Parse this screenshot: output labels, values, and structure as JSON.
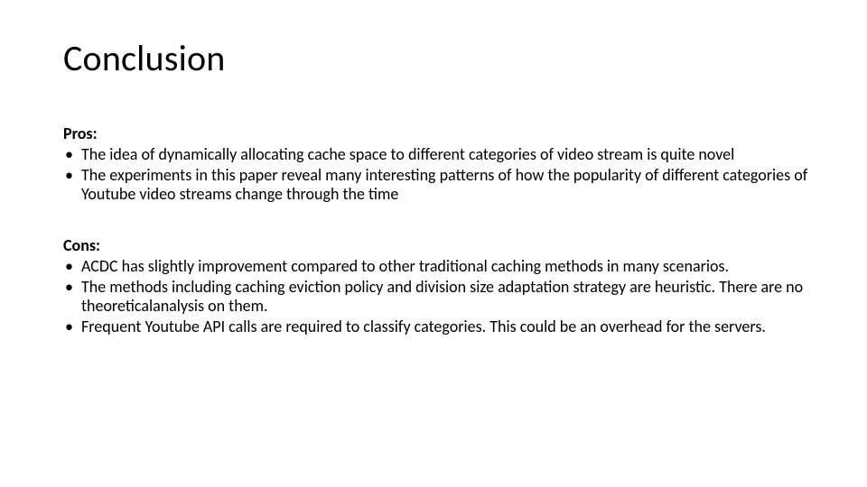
{
  "slide": {
    "title": "Conclusion",
    "pros": {
      "label": "Pros:",
      "items": [
        "The idea of dynamically allocating cache space to different categories of video stream is quite novel",
        "The experiments in this paper reveal many interesting patterns of how the popularity of different categories of Youtube video streams change through the time"
      ]
    },
    "cons": {
      "label": "Cons:",
      "items": [
        "ACDC has slightly improvement compared to other traditional caching methods in many scenarios.",
        "The methods including caching eviction policy and division size adaptation strategy are heuristic. There are no theoreticalanalysis on them.",
        "Frequent Youtube API calls are required to classify categories. This could be an overhead for the servers."
      ]
    }
  }
}
